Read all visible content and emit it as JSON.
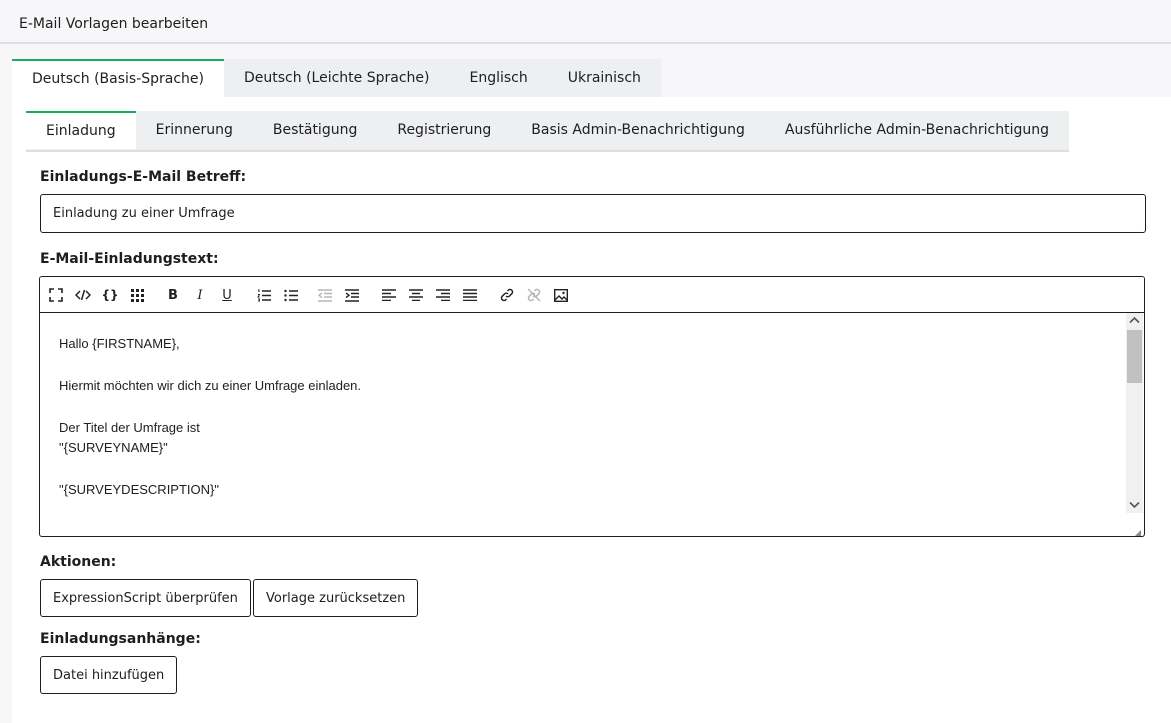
{
  "page": {
    "title": "E-Mail Vorlagen bearbeiten"
  },
  "language_tabs": [
    {
      "label": "Deutsch (Basis-Sprache)",
      "active": true
    },
    {
      "label": "Deutsch (Leichte Sprache)",
      "active": false
    },
    {
      "label": "Englisch",
      "active": false
    },
    {
      "label": "Ukrainisch",
      "active": false
    }
  ],
  "type_tabs": [
    {
      "label": "Einladung",
      "active": true
    },
    {
      "label": "Erinnerung",
      "active": false
    },
    {
      "label": "Bestätigung",
      "active": false
    },
    {
      "label": "Registrierung",
      "active": false
    },
    {
      "label": "Basis Admin-Benachrichtigung",
      "active": false
    },
    {
      "label": "Ausführliche Admin-Benachrichtigung",
      "active": false
    }
  ],
  "subject": {
    "label": "Einladungs-E-Mail Betreff:",
    "value": "Einladung zu einer Umfrage"
  },
  "body": {
    "label": "E-Mail-Einladungstext:",
    "lines": [
      "Hallo {FIRSTNAME},",
      "Hiermit möchten wir dich zu einer Umfrage einladen.",
      "Der Titel der Umfrage ist",
      "\"{SURVEYNAME}\"",
      "\"{SURVEYDESCRIPTION}\""
    ]
  },
  "toolbar": {
    "items": [
      "fullscreen-icon",
      "source-code-icon",
      "expression-icon",
      "placeholder-grid-icon",
      "bold-icon",
      "italic-icon",
      "underline-icon",
      "numbered-list-icon",
      "bulleted-list-icon",
      "outdent-icon",
      "indent-icon",
      "align-left-icon",
      "align-center-icon",
      "align-right-icon",
      "justify-icon",
      "link-icon",
      "unlink-icon",
      "image-icon"
    ]
  },
  "actions": {
    "label": "Aktionen:",
    "check_label": "ExpressionScript überprüfen",
    "reset_label": "Vorlage zurücksetzen"
  },
  "attachments": {
    "label": "Einladungsanhänge:",
    "add_label": "Datei hinzufügen"
  },
  "colors": {
    "accent": "#14ae5c",
    "border": "#1e1e1e",
    "tab_bg": "#eeeff1"
  }
}
